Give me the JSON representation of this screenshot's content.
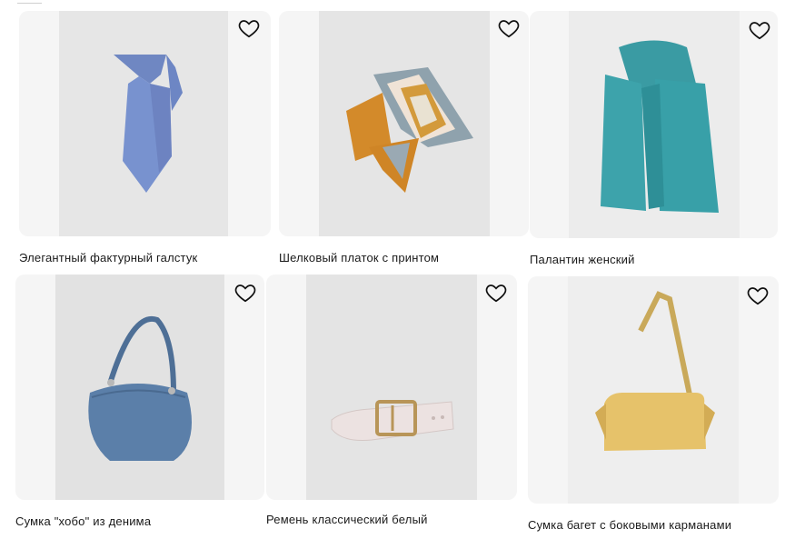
{
  "products": [
    {
      "title": "Элегантный фактурный галстук",
      "icon": "heart-icon",
      "image": "blue-tie"
    },
    {
      "title": "Шелковый платок с принтом",
      "icon": "heart-icon",
      "image": "silk-scarf"
    },
    {
      "title": "Палантин женский",
      "icon": "heart-icon",
      "image": "teal-stole"
    },
    {
      "title": "Сумка \"хобо\" из денима",
      "icon": "heart-icon",
      "image": "denim-hobo-bag"
    },
    {
      "title": "Ремень классический белый",
      "icon": "heart-icon",
      "image": "white-belt"
    },
    {
      "title": "Сумка багет с боковыми карманами",
      "icon": "heart-icon",
      "image": "yellow-baguette-bag"
    }
  ]
}
